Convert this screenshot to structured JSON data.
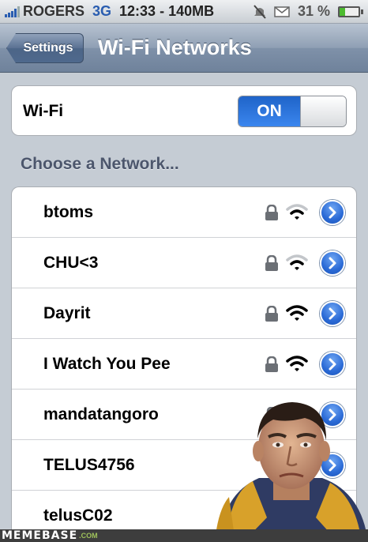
{
  "status_bar": {
    "carrier": "ROGERS",
    "network": "3G",
    "time_data": "12:33 - 140MB",
    "battery_text": "31 %",
    "battery_level": 0.31,
    "icons": [
      "signal-bars-icon",
      "mute-icon",
      "mail-icon",
      "battery-icon"
    ]
  },
  "nav": {
    "back_label": "Settings",
    "title": "Wi-Fi Networks"
  },
  "wifi": {
    "label": "Wi-Fi",
    "toggle_state": "ON"
  },
  "section_header": "Choose a Network...",
  "networks": [
    {
      "name": "btoms",
      "secured": true,
      "signal": "medium"
    },
    {
      "name": "CHU<3",
      "secured": true,
      "signal": "medium"
    },
    {
      "name": "Dayrit",
      "secured": true,
      "signal": "strong"
    },
    {
      "name": "I Watch You Pee",
      "secured": true,
      "signal": "strong"
    },
    {
      "name": "mandatangoro",
      "secured": true,
      "signal": "strong"
    },
    {
      "name": "TELUS4756",
      "secured": true,
      "signal": "strong"
    },
    {
      "name": "telusC02",
      "secured": true,
      "signal": "strong"
    }
  ],
  "watermark": {
    "logo": "MEMEBASE",
    "tld": ".COM"
  },
  "colors": {
    "accent_blue": "#2a6ad6",
    "toggle_on": "#1f64c9",
    "page_bg": "#c5ccd4"
  }
}
